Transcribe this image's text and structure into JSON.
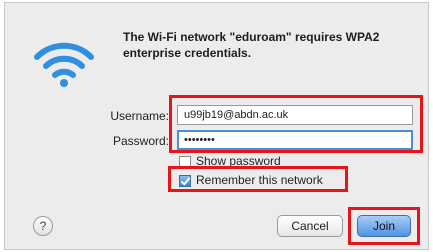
{
  "dialog": {
    "message": "The Wi-Fi network \"eduroam\" requires WPA2 enterprise credentials."
  },
  "form": {
    "username_label": "Username:",
    "username_value": "u99jb19@abdn.ac.uk",
    "password_label": "Password:",
    "password_value": "••••••••",
    "show_password_label": "Show password",
    "remember_label": "Remember this network",
    "remember_checked": true,
    "show_password_checked": false
  },
  "buttons": {
    "help_label": "?",
    "cancel_label": "Cancel",
    "join_label": "Join"
  },
  "icons": {
    "wifi": "wifi-icon",
    "help": "help-icon"
  },
  "colors": {
    "highlight": "#e8131b",
    "wifi_blue": "#2f8fe0",
    "join_blue": "#4f93e2"
  }
}
